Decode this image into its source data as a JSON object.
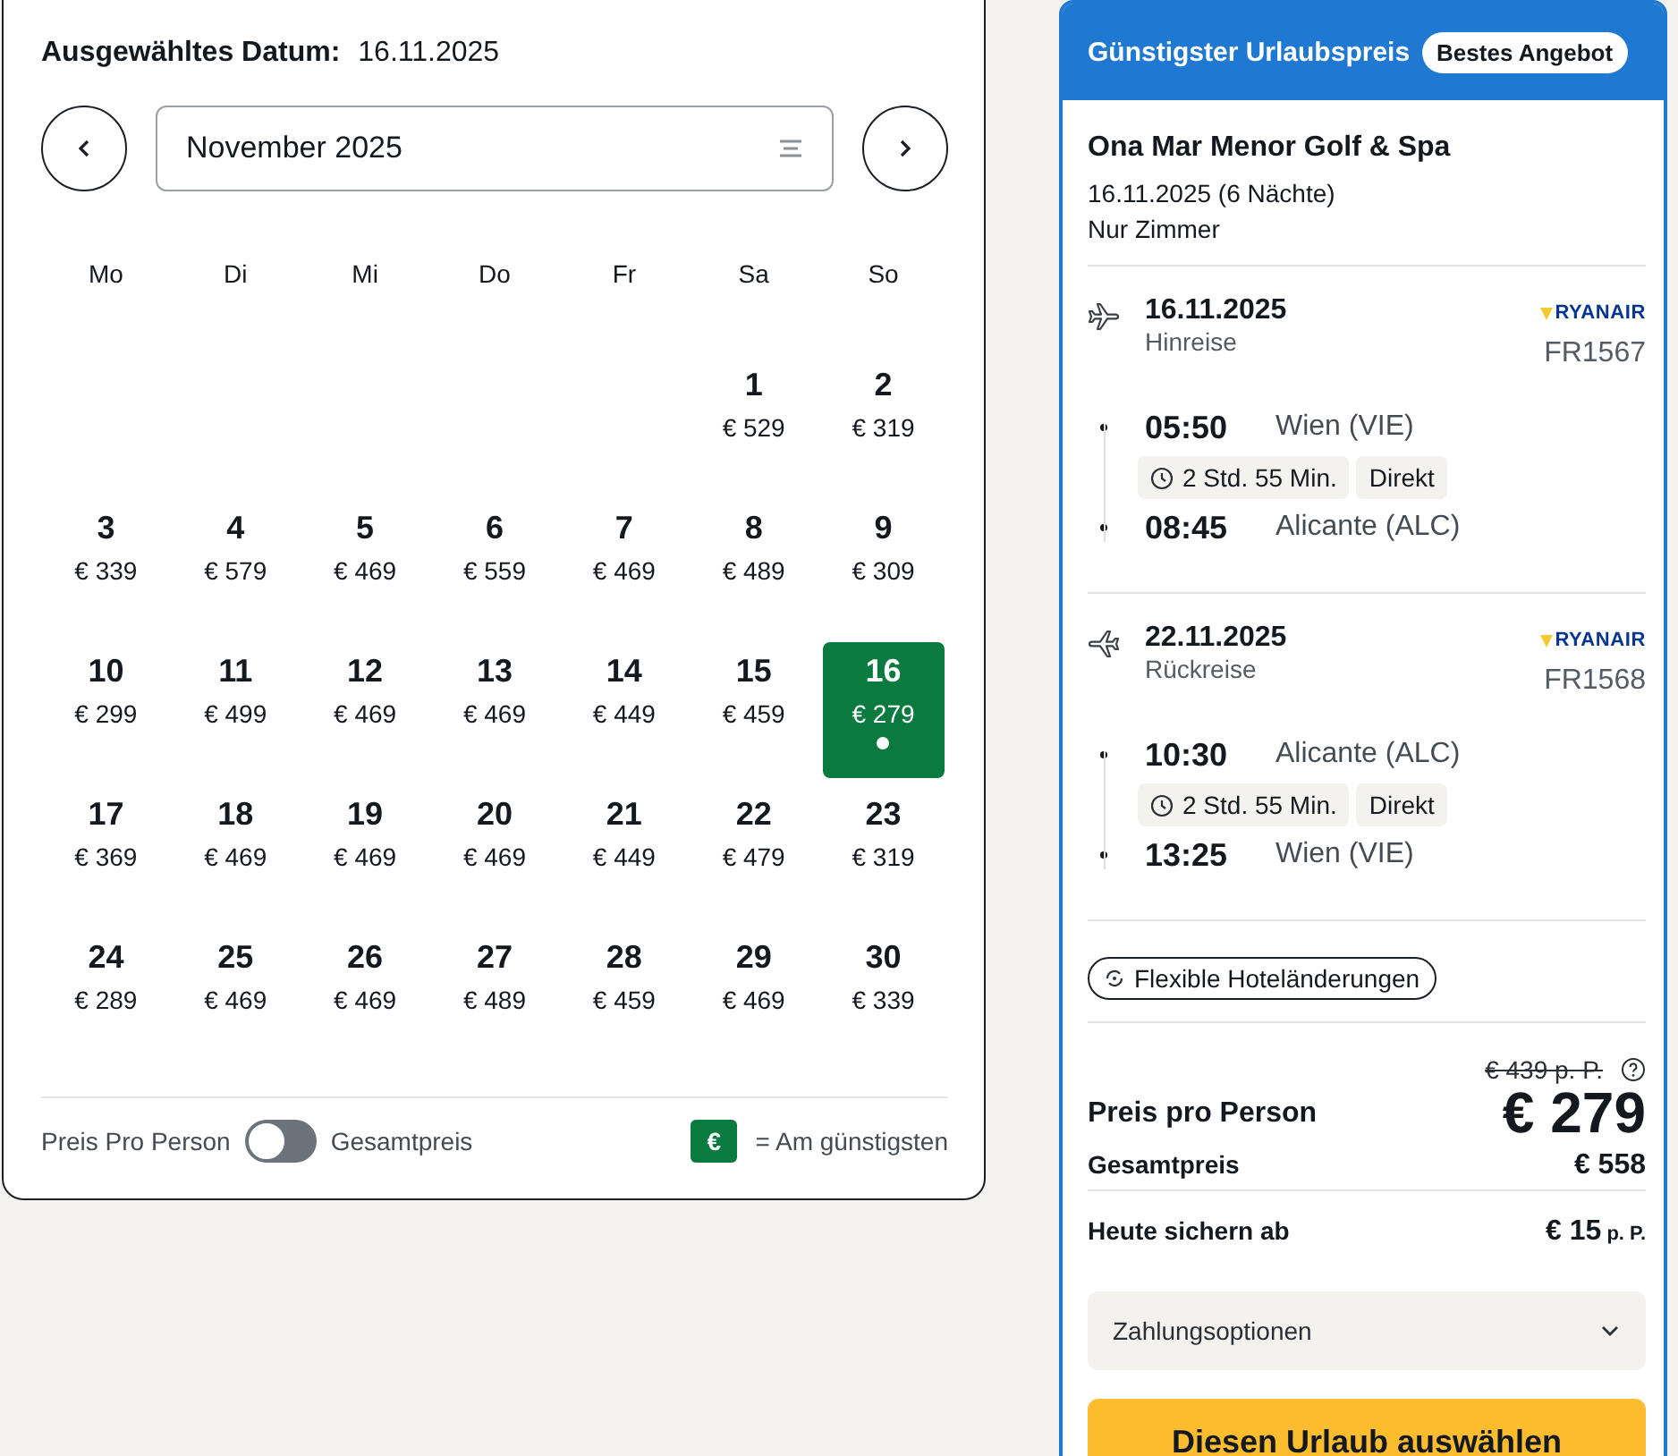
{
  "calendar": {
    "selected_label": "Ausgewähltes Datum:",
    "selected_value": "16.11.2025",
    "month": "November 2025",
    "weekdays": [
      "Mo",
      "Di",
      "Mi",
      "Do",
      "Fr",
      "Sa",
      "So"
    ],
    "weeks": [
      [
        {
          "day": "1",
          "price": "€ 529",
          "selected": false
        },
        {
          "day": "2",
          "price": "€ 319",
          "selected": false
        }
      ],
      [
        {
          "day": "3",
          "price": "€ 339",
          "selected": false
        },
        {
          "day": "4",
          "price": "€ 579",
          "selected": false
        },
        {
          "day": "5",
          "price": "€ 469",
          "selected": false
        },
        {
          "day": "6",
          "price": "€ 559",
          "selected": false
        },
        {
          "day": "7",
          "price": "€ 469",
          "selected": false
        },
        {
          "day": "8",
          "price": "€ 489",
          "selected": false
        },
        {
          "day": "9",
          "price": "€ 309",
          "selected": false
        }
      ],
      [
        {
          "day": "10",
          "price": "€ 299",
          "selected": false
        },
        {
          "day": "11",
          "price": "€ 499",
          "selected": false
        },
        {
          "day": "12",
          "price": "€ 469",
          "selected": false
        },
        {
          "day": "13",
          "price": "€ 469",
          "selected": false
        },
        {
          "day": "14",
          "price": "€ 449",
          "selected": false
        },
        {
          "day": "15",
          "price": "€ 459",
          "selected": false
        },
        {
          "day": "16",
          "price": "€ 279",
          "selected": true
        }
      ],
      [
        {
          "day": "17",
          "price": "€ 369",
          "selected": false
        },
        {
          "day": "18",
          "price": "€ 469",
          "selected": false
        },
        {
          "day": "19",
          "price": "€ 469",
          "selected": false
        },
        {
          "day": "20",
          "price": "€ 469",
          "selected": false
        },
        {
          "day": "21",
          "price": "€ 449",
          "selected": false
        },
        {
          "day": "22",
          "price": "€ 479",
          "selected": false
        },
        {
          "day": "23",
          "price": "€ 319",
          "selected": false
        }
      ],
      [
        {
          "day": "24",
          "price": "€ 289",
          "selected": false
        },
        {
          "day": "25",
          "price": "€ 469",
          "selected": false
        },
        {
          "day": "26",
          "price": "€ 469",
          "selected": false
        },
        {
          "day": "27",
          "price": "€ 489",
          "selected": false
        },
        {
          "day": "28",
          "price": "€ 459",
          "selected": false
        },
        {
          "day": "29",
          "price": "€ 469",
          "selected": false
        },
        {
          "day": "30",
          "price": "€ 339",
          "selected": false
        }
      ]
    ],
    "price_toggle": {
      "left_label": "Preis Pro Person",
      "right_label": "Gesamtpreis",
      "on": false
    },
    "legend": {
      "symbol": "€",
      "label": "= Am günstigsten"
    }
  },
  "offer": {
    "title": "Günstigster Urlaubspreis",
    "badge": "Bestes Angebot",
    "hotel": "Ona Mar Menor Golf & Spa",
    "stay": "16.11.2025 (6 Nächte)",
    "board": "Nur Zimmer",
    "flights": [
      {
        "kind": "outbound",
        "date": "16.11.2025",
        "direction": "Hinreise",
        "airline": "RYANAIR",
        "flight_number": "FR1567",
        "departure_time": "05:50",
        "departure_place": "Wien (VIE)",
        "duration": "2 Std. 55 Min.",
        "stops": "Direkt",
        "arrival_time": "08:45",
        "arrival_place": "Alicante (ALC)"
      },
      {
        "kind": "return",
        "date": "22.11.2025",
        "direction": "Rückreise",
        "airline": "RYANAIR",
        "flight_number": "FR1568",
        "departure_time": "10:30",
        "departure_place": "Alicante (ALC)",
        "duration": "2 Std. 55 Min.",
        "stops": "Direkt",
        "arrival_time": "13:25",
        "arrival_place": "Wien (VIE)"
      }
    ],
    "flex_chip": "Flexible Hoteländerungen",
    "old_price": "€ 439 p. P.",
    "price_label": "Preis pro Person",
    "price": "€ 279",
    "total_label": "Gesamtpreis",
    "total": "€ 558",
    "deposit_label": "Heute sichern ab",
    "deposit": "€ 15",
    "deposit_unit": "p. P.",
    "payment_options": "Zahlungsoptionen",
    "cta": "Diesen Urlaub auswählen"
  }
}
